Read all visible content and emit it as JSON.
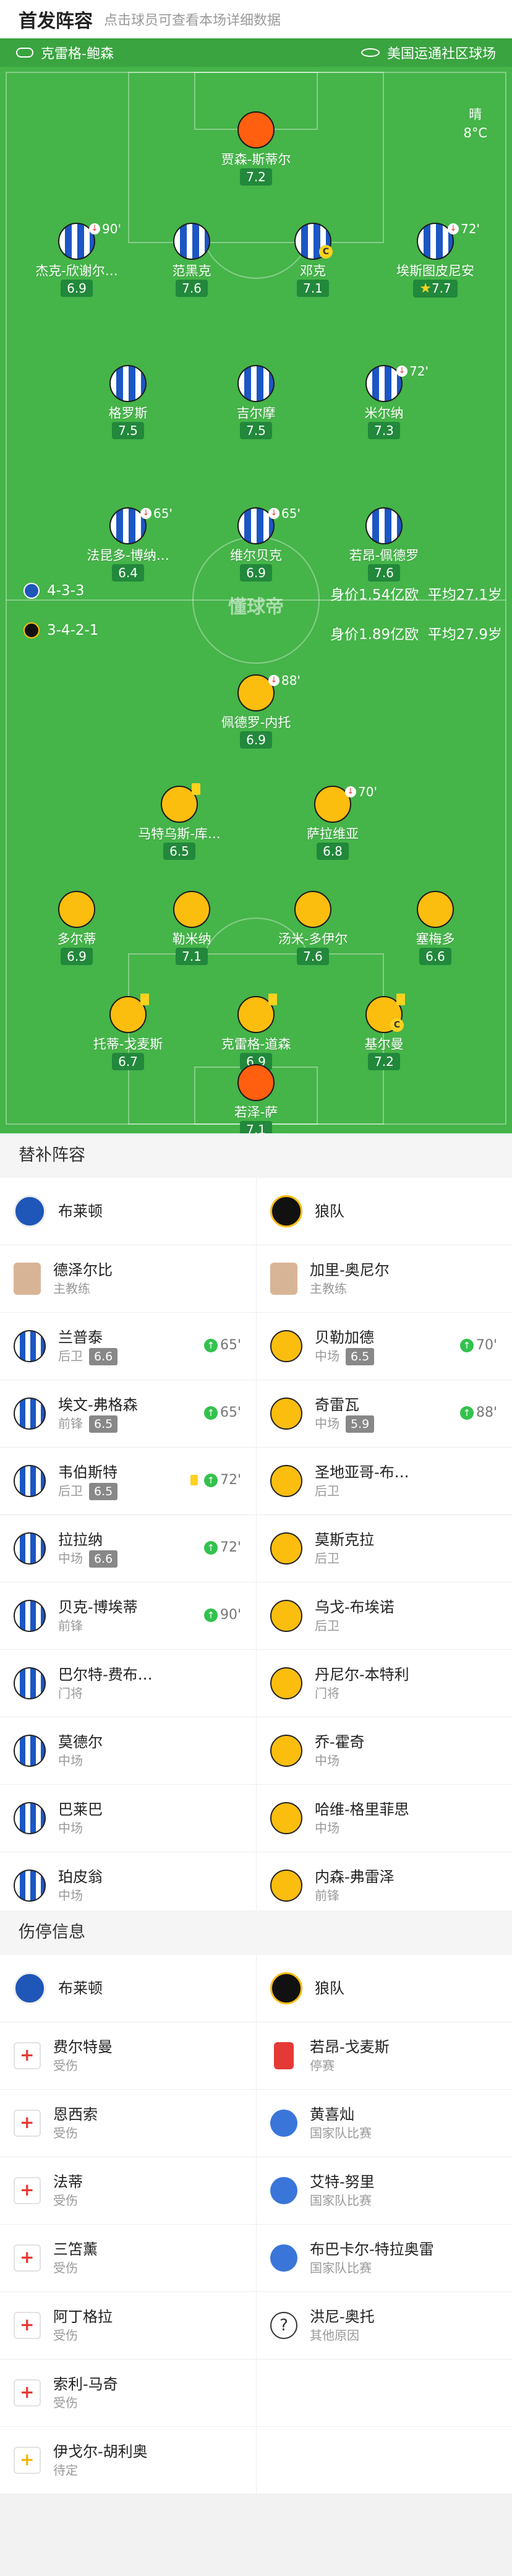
{
  "header": {
    "title": "首发阵容",
    "subtitle": "点击球员可查看本场详细数据"
  },
  "match": {
    "referee": "克雷格-鲍森",
    "venue": "美国运通社区球场",
    "weather": "晴",
    "temp": "8°C"
  },
  "home": {
    "formation": "4-3-3",
    "value": "身价1.54亿欧",
    "age": "平均27.1岁"
  },
  "away": {
    "formation": "3-4-2-1",
    "value": "身价1.89亿欧",
    "age": "平均27.9岁"
  },
  "pitch_logo": "懂球帝",
  "home_players": [
    {
      "name": "贾森-斯蒂尔",
      "rating": "7.2",
      "kit": "gkb"
    },
    {
      "name": "杰克-欣谢尔…",
      "rating": "6.9",
      "kit": "bri",
      "sub": "90'"
    },
    {
      "name": "范黑克",
      "rating": "7.6",
      "kit": "bri"
    },
    {
      "name": "邓克",
      "rating": "7.1",
      "kit": "bri",
      "cap": "C"
    },
    {
      "name": "埃斯图皮尼安",
      "rating": "7.7",
      "kit": "bri",
      "sub": "72'",
      "star": "★"
    },
    {
      "name": "格罗斯",
      "rating": "7.5",
      "kit": "bri"
    },
    {
      "name": "吉尔摩",
      "rating": "7.5",
      "kit": "bri"
    },
    {
      "name": "米尔纳",
      "rating": "7.3",
      "kit": "bri",
      "sub": "72'"
    },
    {
      "name": "法昆多-博纳…",
      "rating": "6.4",
      "kit": "bri",
      "sub": "65'"
    },
    {
      "name": "维尔贝克",
      "rating": "6.9",
      "kit": "bri",
      "sub": "65'"
    },
    {
      "name": "若昂-佩德罗",
      "rating": "7.6",
      "kit": "bri"
    }
  ],
  "away_players": [
    {
      "name": "佩德罗-内托",
      "rating": "6.9",
      "kit": "wol",
      "sub": "88'"
    },
    {
      "name": "马特乌斯-库…",
      "rating": "6.5",
      "kit": "wol",
      "card": true
    },
    {
      "name": "萨拉维亚",
      "rating": "6.8",
      "kit": "wol",
      "sub": "70'"
    },
    {
      "name": "多尔蒂",
      "rating": "6.9",
      "kit": "wol"
    },
    {
      "name": "勒米纳",
      "rating": "7.1",
      "kit": "wol"
    },
    {
      "name": "汤米-多伊尔",
      "rating": "7.6",
      "kit": "wol"
    },
    {
      "name": "塞梅多",
      "rating": "6.6",
      "kit": "wol"
    },
    {
      "name": "托蒂-戈麦斯",
      "rating": "6.7",
      "kit": "wol",
      "card": true
    },
    {
      "name": "克雷格-道森",
      "rating": "6.9",
      "kit": "wol",
      "card": true
    },
    {
      "name": "基尔曼",
      "rating": "7.2",
      "kit": "wol",
      "cap": "C",
      "card": true
    },
    {
      "name": "若泽-萨",
      "rating": "7.1",
      "kit": "gkw"
    }
  ],
  "subs": {
    "title": "替补阵容",
    "home_team": "布莱顿",
    "away_team": "狼队",
    "coach_label": "主教练",
    "home_coach": "德泽尔比",
    "away_coach": "加里-奥尼尔",
    "rows": [
      [
        {
          "name": "兰普泰",
          "pos": "后卫",
          "rating": "6.6",
          "in": "65'"
        },
        {
          "name": "贝勒加德",
          "pos": "中场",
          "rating": "6.5",
          "in": "70'"
        }
      ],
      [
        {
          "name": "埃文-弗格森",
          "pos": "前锋",
          "rating": "6.5",
          "in": "65'"
        },
        {
          "name": "奇雷瓦",
          "pos": "中场",
          "rating": "5.9",
          "in": "88'"
        }
      ],
      [
        {
          "name": "韦伯斯特",
          "pos": "后卫",
          "rating": "6.5",
          "in": "72'",
          "card": true
        },
        {
          "name": "圣地亚哥-布…",
          "pos": "后卫"
        }
      ],
      [
        {
          "name": "拉拉纳",
          "pos": "中场",
          "rating": "6.6",
          "in": "72'"
        },
        {
          "name": "莫斯克拉",
          "pos": "后卫"
        }
      ],
      [
        {
          "name": "贝克-博埃蒂",
          "pos": "前锋",
          "in": "90'"
        },
        {
          "name": "乌戈-布埃诺",
          "pos": "后卫"
        }
      ],
      [
        {
          "name": "巴尔特-费布…",
          "pos": "门将"
        },
        {
          "name": "丹尼尔-本特利",
          "pos": "门将"
        }
      ],
      [
        {
          "name": "莫德尔",
          "pos": "中场"
        },
        {
          "name": "乔-霍奇",
          "pos": "中场"
        }
      ],
      [
        {
          "name": "巴莱巴",
          "pos": "中场"
        },
        {
          "name": "哈维-格里菲思",
          "pos": "中场"
        }
      ],
      [
        {
          "name": "珀皮翁",
          "pos": "中场"
        },
        {
          "name": "内森-弗雷泽",
          "pos": "前锋"
        }
      ]
    ]
  },
  "injuries": {
    "title": "伤停信息",
    "home_team": "布莱顿",
    "away_team": "狼队",
    "rows": [
      [
        {
          "name": "费尔特曼",
          "reason": "受伤",
          "icon": "medical-icon"
        },
        {
          "name": "若昂-戈麦斯",
          "reason": "停赛",
          "icon": "red-card-icon"
        }
      ],
      [
        {
          "name": "恩西索",
          "reason": "受伤",
          "icon": "medical-icon"
        },
        {
          "name": "黄喜灿",
          "reason": "国家队比赛",
          "icon": "globe-icon"
        }
      ],
      [
        {
          "name": "法蒂",
          "reason": "受伤",
          "icon": "medical-icon"
        },
        {
          "name": "艾特-努里",
          "reason": "国家队比赛",
          "icon": "globe-icon"
        }
      ],
      [
        {
          "name": "三笘薰",
          "reason": "受伤",
          "icon": "medical-icon"
        },
        {
          "name": "布巴卡尔-特拉奥雷",
          "reason": "国家队比赛",
          "icon": "globe-icon"
        }
      ],
      [
        {
          "name": "阿丁格拉",
          "reason": "受伤",
          "icon": "medical-icon"
        },
        {
          "name": "洪尼-奥托",
          "reason": "其他原因",
          "icon": "question-icon"
        }
      ],
      [
        {
          "name": "索利-马奇",
          "reason": "受伤",
          "icon": "medical-icon"
        },
        null
      ],
      [
        {
          "name": "伊戈尔-胡利奥",
          "reason": "待定",
          "icon": "medical-icon"
        },
        null
      ]
    ]
  }
}
